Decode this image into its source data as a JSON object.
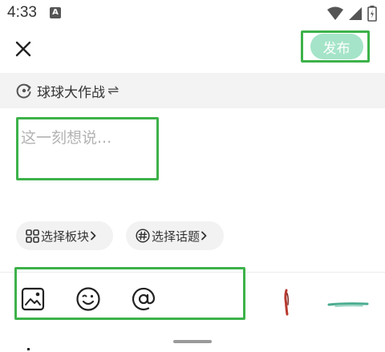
{
  "status_bar": {
    "time": "4:33",
    "notification_badge": "A",
    "icons": [
      "wifi-icon",
      "cellular-signal-icon",
      "battery-icon"
    ]
  },
  "header": {
    "close_icon": "close-icon",
    "publish_label": "发布",
    "publish_color": "#a5e4c8"
  },
  "game": {
    "name": "球球大作战",
    "switch_glyph": "⇌",
    "icon": "refresh-circle-icon"
  },
  "editor": {
    "placeholder": "这一刻想说...",
    "value": ""
  },
  "chips": {
    "board_label": "选择板块",
    "topic_label": "选择话题"
  },
  "toolbar": {
    "items": [
      "image-icon",
      "emoji-icon",
      "at-mention-icon"
    ]
  },
  "colors": {
    "highlight_border": "#3db24a",
    "accent_publish": "#a5e4c8",
    "game_row_bg": "#f3f3f3",
    "chip_bg": "#f2f2f2"
  }
}
